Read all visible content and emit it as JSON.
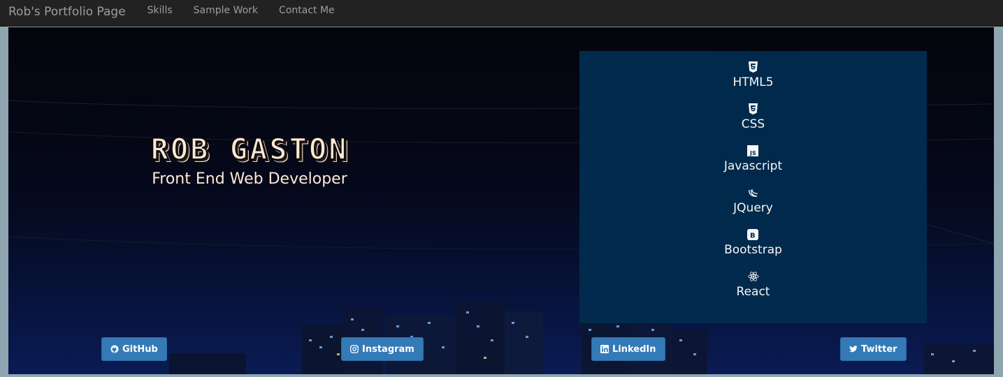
{
  "navbar": {
    "brand": "Rob's Portfolio Page",
    "links": [
      "Skills",
      "Sample Work",
      "Contact Me"
    ]
  },
  "hero": {
    "name": "ROB GASTON",
    "role": "Front End Web Developer"
  },
  "skills": [
    {
      "icon": "html5-icon",
      "label": "HTML5"
    },
    {
      "icon": "css3-icon",
      "label": "CSS"
    },
    {
      "icon": "javascript-icon",
      "label": "Javascript"
    },
    {
      "icon": "jquery-icon",
      "label": "JQuery"
    },
    {
      "icon": "bootstrap-icon",
      "label": "Bootstrap"
    },
    {
      "icon": "react-icon",
      "label": "React"
    }
  ],
  "social": [
    {
      "icon": "github-icon",
      "label": "GitHub"
    },
    {
      "icon": "instagram-icon",
      "label": "Instagram"
    },
    {
      "icon": "linkedin-icon",
      "label": "LinkedIn"
    },
    {
      "icon": "twitter-icon",
      "label": "Twitter"
    }
  ],
  "colors": {
    "navbar": "#222222",
    "nav_text": "#9d9d9d",
    "panel": "#012b4e",
    "button": "#337ab7",
    "name_text": "#fde8d6"
  }
}
